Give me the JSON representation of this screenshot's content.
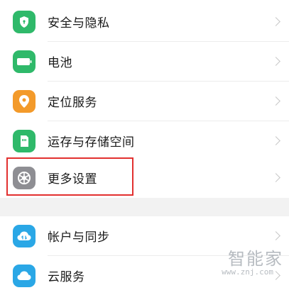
{
  "settings": {
    "items": [
      {
        "label": "安全与隐私",
        "icon": "shield-icon",
        "color": "#2fb96a"
      },
      {
        "label": "电池",
        "icon": "battery-icon",
        "color": "#2fb96a"
      },
      {
        "label": "定位服务",
        "icon": "location-pin-icon",
        "color": "#f39a2a"
      },
      {
        "label": "运存与存储空间",
        "icon": "storage-icon",
        "color": "#2fb96a"
      },
      {
        "label": "更多设置",
        "icon": "gear-icon",
        "color": "#8e8e93"
      }
    ],
    "items2": [
      {
        "label": "帐户与同步",
        "icon": "cloud-sync-icon",
        "color": "#2aa7e6"
      },
      {
        "label": "云服务",
        "icon": "cloud-icon",
        "color": "#2aa7e6"
      }
    ]
  },
  "highlight": {
    "target": "更多设置",
    "color": "#e2302f"
  },
  "watermark": {
    "text": "智能家",
    "url": "www.znj.com"
  }
}
